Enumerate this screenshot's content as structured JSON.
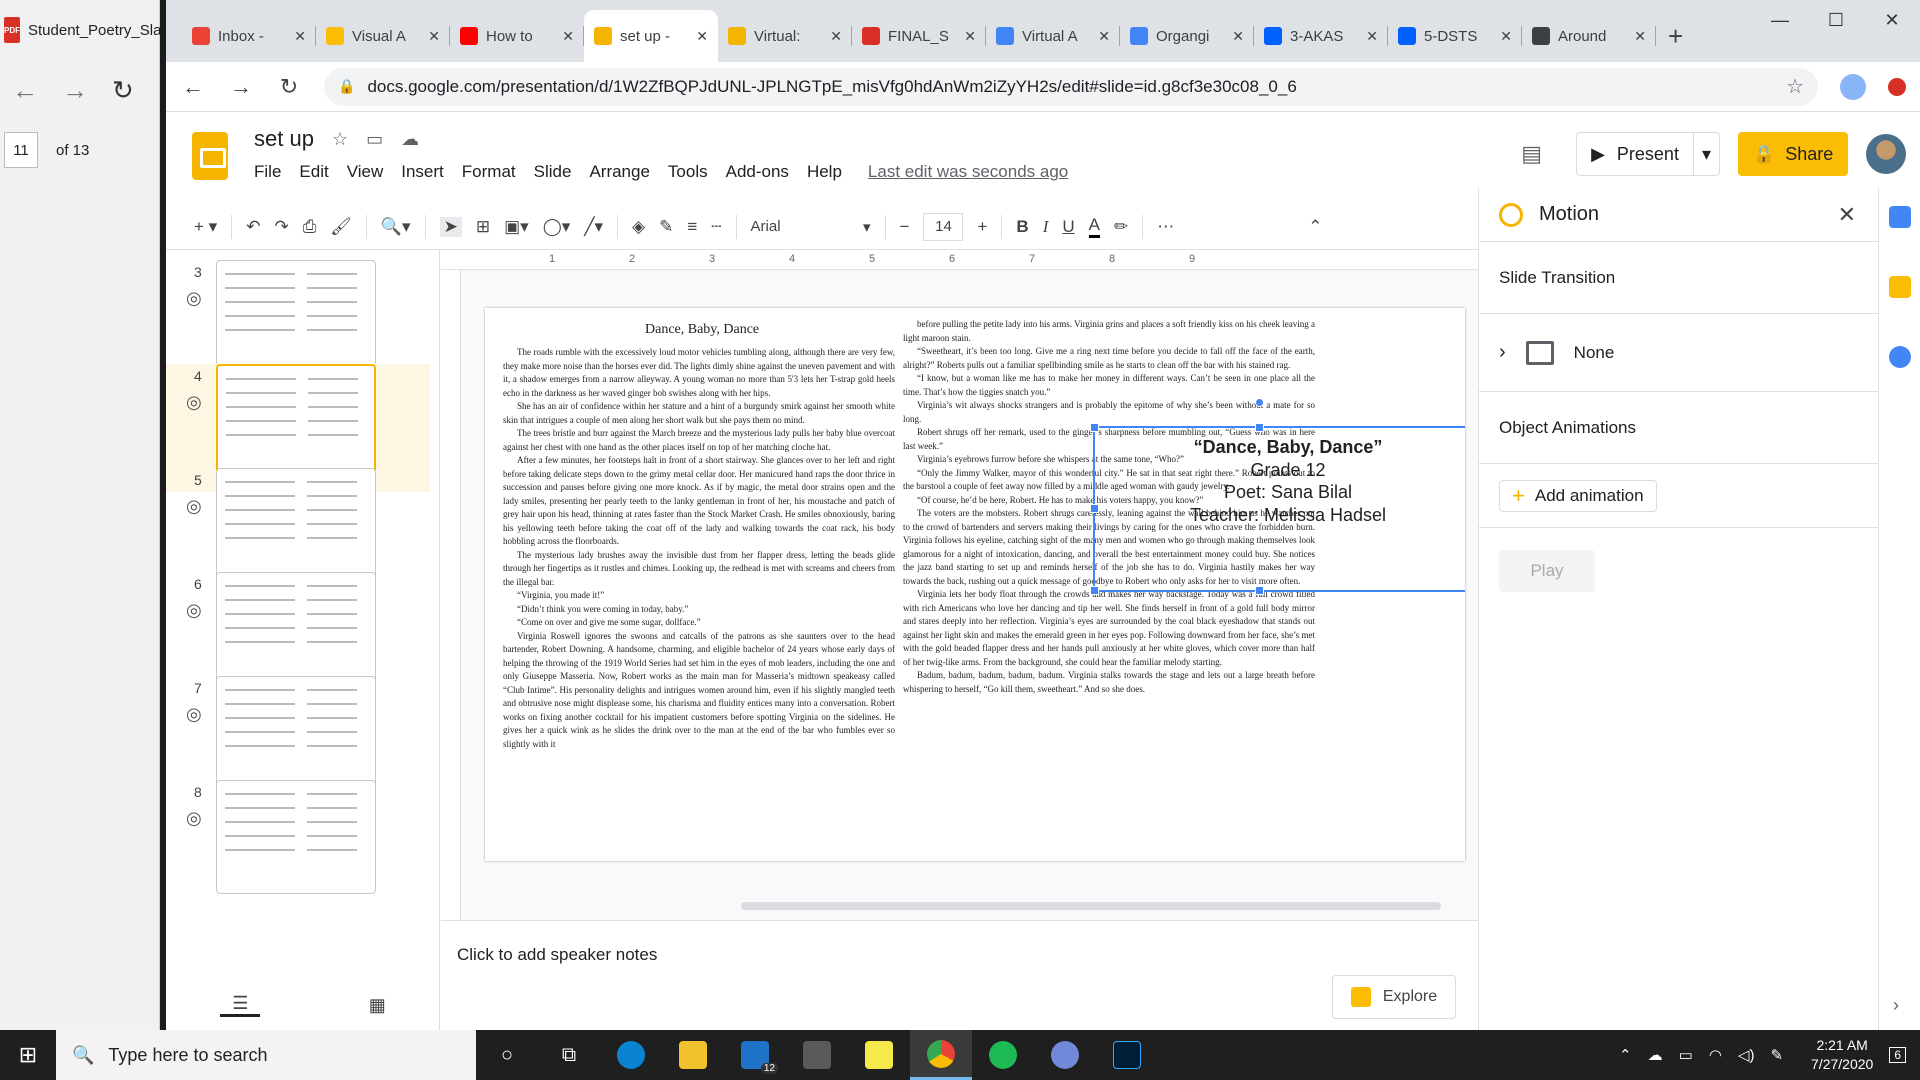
{
  "pdf_viewer": {
    "tab_title": "Student_Poetry_Sla",
    "current_page": "11",
    "page_total": "of 13"
  },
  "browser": {
    "tabs": [
      {
        "title": "Inbox -",
        "icon": "gmail-icon",
        "color": "#ea4335"
      },
      {
        "title": "Visual A",
        "icon": "pinwheel-icon",
        "color": "#fbbc04"
      },
      {
        "title": "How to",
        "icon": "youtube-icon",
        "color": "#ff0000"
      },
      {
        "title": "set up -",
        "icon": "slides-icon",
        "color": "#f4b400",
        "active": true
      },
      {
        "title": "Virtual:",
        "icon": "slides-icon",
        "color": "#f4b400"
      },
      {
        "title": "FINAL_S",
        "icon": "pdf-icon",
        "color": "#d93025"
      },
      {
        "title": "Virtual A",
        "icon": "docs-icon",
        "color": "#4285f4"
      },
      {
        "title": "Organgi",
        "icon": "docs-icon",
        "color": "#4285f4"
      },
      {
        "title": "3-AKAS",
        "icon": "dropbox-icon",
        "color": "#0061ff"
      },
      {
        "title": "5-DSTS",
        "icon": "dropbox-icon",
        "color": "#0061ff"
      },
      {
        "title": "Around",
        "icon": "classroom-icon",
        "color": "#3c4043"
      }
    ],
    "url": "docs.google.com/presentation/d/1W2ZfBQPJdUNL-JPLNGTpE_misVfg0hdAnWm2iZyYH2s/edit#slide=id.g8cf3e30c08_0_6"
  },
  "doc": {
    "title": "set up",
    "last_edit": "Last edit was seconds ago",
    "menus": [
      "File",
      "Edit",
      "View",
      "Insert",
      "Format",
      "Slide",
      "Arrange",
      "Tools",
      "Add-ons",
      "Help"
    ],
    "present_label": "Present",
    "share_label": "Share"
  },
  "toolbar": {
    "font": "Arial",
    "font_size": "14"
  },
  "filmstrip": {
    "slides": [
      {
        "num": "3"
      },
      {
        "num": "4",
        "selected": true
      },
      {
        "num": "5"
      },
      {
        "num": "6"
      },
      {
        "num": "7"
      },
      {
        "num": "8"
      }
    ]
  },
  "slide": {
    "title": "Dance, Baby, Dance",
    "col1": [
      "The roads rumble with the excessively loud motor vehicles tumbling along, although there are very few, they make more noise than the horses ever did. The lights dimly shine against the uneven pavement and with it, a shadow emerges from a narrow alleyway. A young woman no more than 5'3 lets her T-strap gold heels echo in the darkness as her waved ginger bob swishes along with her hips.",
      "She has an air of confidence within her stature and a hint of a burgundy smirk against her smooth white skin that intrigues a couple of men along her short walk but she pays them no mind.",
      "The trees bristle and burr against the March breeze and the mysterious lady pulls her baby blue overcoat against her chest with one hand as the other places itself on top of her matching cloche hat.",
      "After a few minutes, her footsteps halt in front of a short stairway. She glances over to her left and right before taking delicate steps down to the grimy metal cellar door. Her manicured hand raps the door thrice in succession and pauses before giving one more knock. As if by magic, the metal door strains open and the lady smiles, presenting her pearly teeth to the lanky gentleman in front of her, his moustache and patch of grey hair upon his head, thinning at rates faster than the Stock Market Crash. He smiles obnoxiously, baring his yellowing teeth before taking the coat off of the lady and walking towards the coat rack, his body hobbling across the floorboards.",
      "The mysterious lady brushes away the invisible dust from her flapper dress, letting the beads glide through her fingertips as it rustles and chimes. Looking up, the redhead is met with screams and cheers from the illegal bar.",
      "“Virginia, you made it!”",
      "“Didn’t think you were coming in today, baby.”",
      "“Come on over and give me some sugar, dollface.”",
      "Virginia Roswell ignores the swoons and catcalls of the patrons as she saunters over to the head bartender, Robert Downing. A handsome, charming, and eligible bachelor of 24 years whose early days of helping the throwing of the 1919 World Series had set him in the eyes of mob leaders, including the one and only Giuseppe Masseria. Now, Robert works as the main man for Masseria’s midtown speakeasy called “Club Intime”. His personality delights and intrigues women around him, even if his slightly mangled teeth and obtrusive nose might displease some, his charisma and fluidity entices many into a conversation. Robert works on fixing another cocktail for his impatient customers before spotting Virginia on the sidelines. He gives her a quick wink as he slides the drink over to the man at the end of the bar who fumbles ever so slightly with it"
    ],
    "col2": [
      "before pulling the petite lady into his arms. Virginia grins and places a soft friendly kiss on his cheek leaving a light maroon stain.",
      "“Sweetheart, it’s been too long. Give me a ring next time before you decide to fall off the face of the earth, alright?” Roberts pulls out a familiar spellbinding smile as he starts to clean off the bar with his stained rag.",
      "“I know, but a woman like me has to make her money in different ways. Can’t be seen in one place all the time. That’s how the tiggies snatch you.”",
      "Virginia’s wit always shocks strangers and is probably the epitome of why she’s been without a mate for so long.",
      "Robert shrugs off her remark, used to the ginger’s sharpness before mumbling out, “Guess who was in here last week.”",
      "Virginia’s eyebrows furrow before she whispers at the same tone, “Who?”",
      "“Only the Jimmy Walker, mayor of this wonderful city.” He sat in that seat right there.” Robert points out to the barstool a couple of feet away now filled by a middle aged woman with gaudy jewelry.",
      "“Of course, he’d be here, Robert. He has to make his voters happy, you know?”",
      "The voters are the mobsters. Robert shrugs carelessly, leaning against the wall behind him as he watches out to the crowd of bartenders and servers making their livings by caring for the ones who crave the forbidden burn. Virginia follows his eyeline, catching sight of the many men and women who go through making themselves look glamorous for a night of intoxication, dancing, and overall the best entertainment money could buy. She notices the jazz band starting to set up and reminds herself of the job she has to do. Virginia hastily makes her way towards the back, rushing out a quick message of goodbye to Robert who only asks for her to visit more often.",
      "Virginia lets her body float through the crowds and makes her way backstage. Today was a full crowd filled with rich Americans who love her dancing and tip her well. She finds herself in front of a gold full body mirror and stares deeply into her reflection. Virginia’s eyes are surrounded by the coal black eyeshadow that stands out against her light skin and makes the emerald green in her eyes pop. Following downward from her face, she’s met with the gold beaded flapper dress and her hands pull anxiously at her white gloves, which cover more than half of her twig-like arms. From the background, she could hear the familiar melody starting.",
      "Badum, badum, badum, badum, badum. Virginia stalks towards the stage and lets out a large breath before whispering to herself, “Go kill them, sweetheart.” And so she does."
    ],
    "info": {
      "heading": "“Dance, Baby, Dance”",
      "grade": "Grade 12",
      "poet": "Poet: Sana Bilal",
      "teacher": "Teacher: Melissa Hadsel"
    }
  },
  "notes": {
    "placeholder": "Click to add speaker notes"
  },
  "explore_label": "Explore",
  "motion": {
    "title": "Motion",
    "slide_transition": "Slide Transition",
    "transition_value": "None",
    "object_animations": "Object Animations",
    "add_animation": "Add animation",
    "play": "Play"
  },
  "taskbar": {
    "search_placeholder": "Type here to search",
    "time": "2:21 AM",
    "date": "7/27/2020",
    "notifications": "6",
    "mail_badge": "12"
  }
}
